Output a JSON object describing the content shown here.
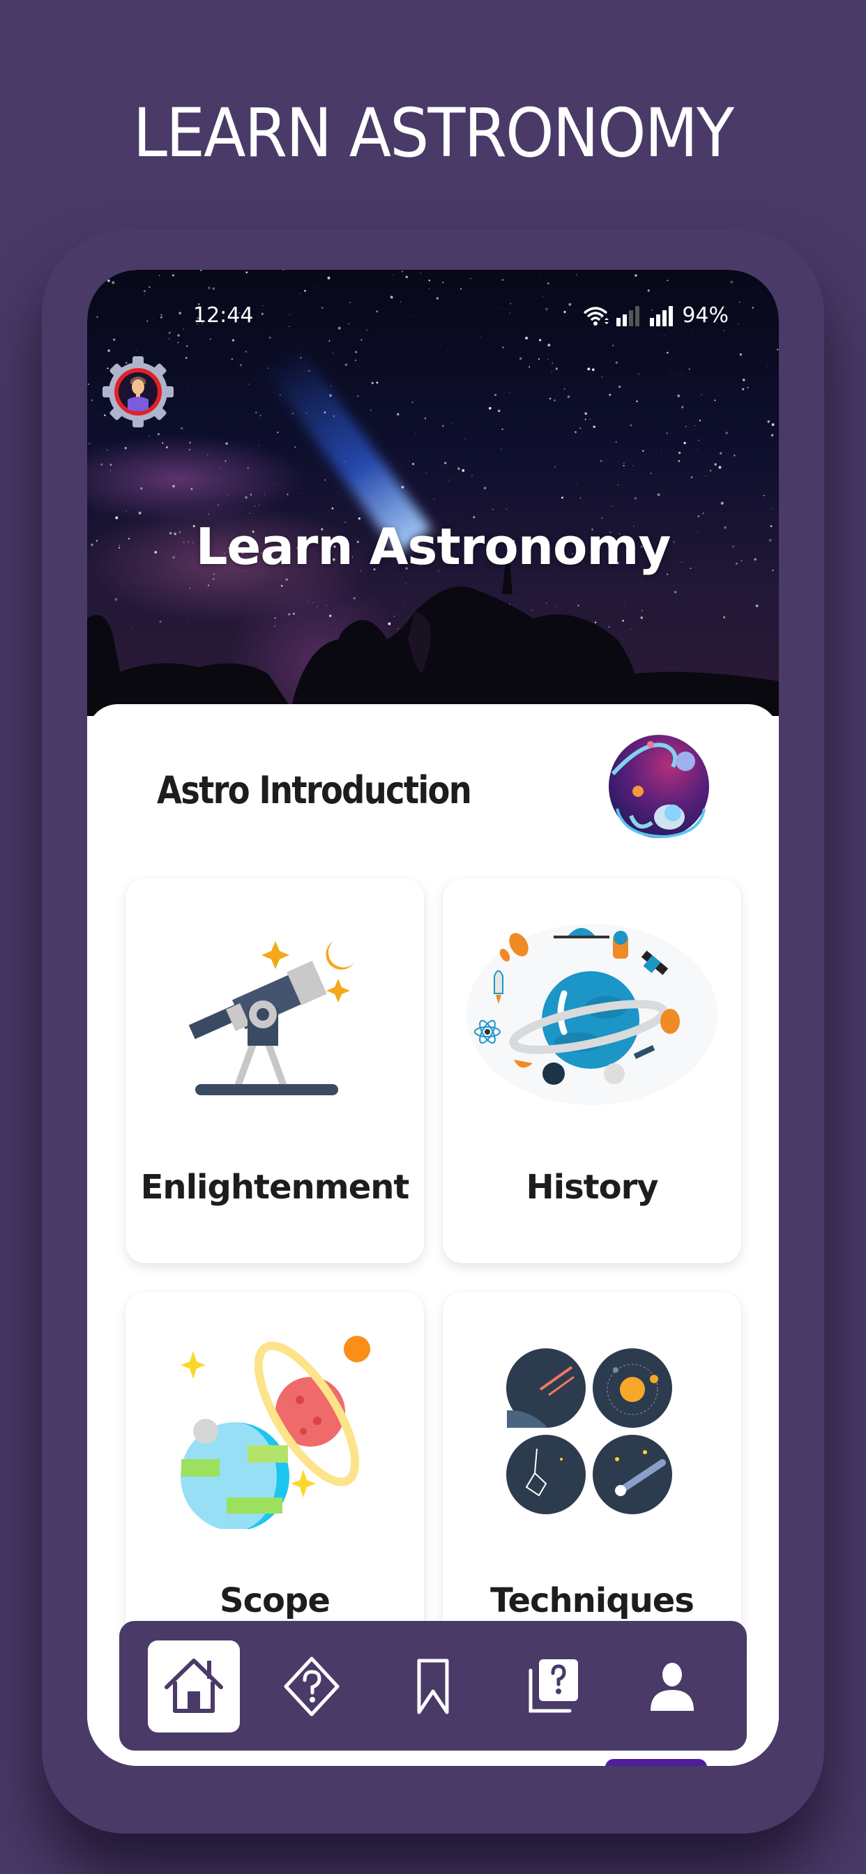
{
  "promo": {
    "title": "LEARN ASTRONOMY"
  },
  "status_bar": {
    "time": "12:44",
    "battery": "94%",
    "icons": [
      "wifi-icon",
      "signal-sim1-icon",
      "signal-sim2-icon"
    ]
  },
  "hero": {
    "title": "Learn Astronomy",
    "profile_icon": "profile-settings-icon"
  },
  "section": {
    "title": "Astro Introduction",
    "icon": "astronaut-icon"
  },
  "cards": [
    {
      "label": "Enlightenment",
      "icon": "telescope-icon"
    },
    {
      "label": "History",
      "icon": "planet-history-icon"
    },
    {
      "label": "Scope",
      "icon": "planets-icon"
    },
    {
      "label": "Techniques",
      "icon": "sky-techniques-icon"
    }
  ],
  "bottom_nav": {
    "active_index": 0,
    "items": [
      {
        "name": "home",
        "icon": "home-icon"
      },
      {
        "name": "quiz",
        "icon": "diamond-question-icon"
      },
      {
        "name": "bookmarks",
        "icon": "bookmark-icon"
      },
      {
        "name": "questions",
        "icon": "question-cards-icon"
      },
      {
        "name": "profile",
        "icon": "user-icon"
      }
    ]
  },
  "colors": {
    "background": "#4a3a68",
    "nav": "#4a3a68",
    "accent": "#4e1f9a",
    "text": "#1d1d1d"
  }
}
